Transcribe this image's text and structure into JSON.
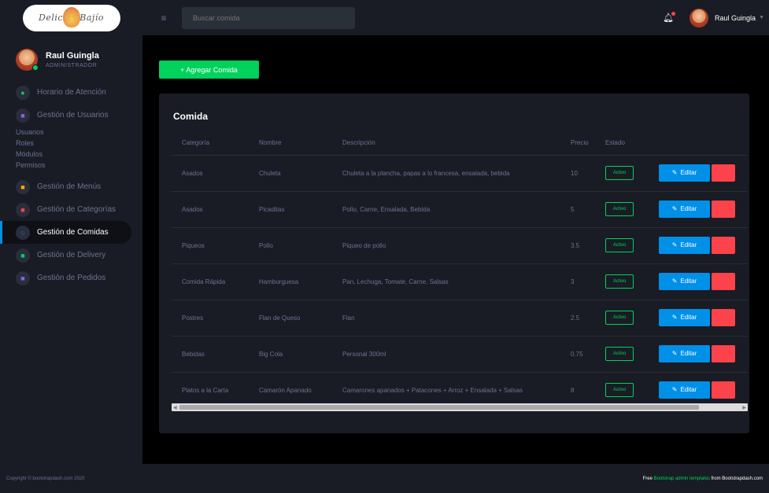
{
  "brand": {
    "logo_text": "Delicias Bajío"
  },
  "profile": {
    "name": "Raul Guingla",
    "role": "ADMINISTRADOR"
  },
  "sidebar": {
    "items": [
      {
        "label": "Horario de Atención",
        "icon": "●"
      },
      {
        "label": "Gestión de Usuarios",
        "icon": "■"
      },
      {
        "label": "Gestión de Menús",
        "icon": "■"
      },
      {
        "label": "Gestión de Categorías",
        "icon": "■"
      },
      {
        "label": "Gestión de Comidas",
        "icon": "○"
      },
      {
        "label": "Gestión de Delivery",
        "icon": "■"
      },
      {
        "label": "Gestión de Pedidos",
        "icon": "■"
      }
    ],
    "submenu": [
      "Usuarios",
      "Roles",
      "Módulos",
      "Permisos"
    ]
  },
  "topbar": {
    "search_placeholder": "Buscar comida",
    "user_name": "Raul Guingla"
  },
  "main": {
    "add_button": "+ Agregar Comida",
    "card_title": "Comida",
    "columns": [
      "Categoría",
      "Nombre",
      "Descripción",
      "Precio",
      "Estado",
      ""
    ],
    "rows": [
      {
        "categoria": "Asados",
        "nombre": "Chuleta",
        "descripcion": "Chuleta a la plancha, papas a lo francesa, ensalada, bebida",
        "precio": "10",
        "estado": "Activo"
      },
      {
        "categoria": "Asados",
        "nombre": "Picaditas",
        "descripcion": "Pollo, Carne, Ensalada, Bebida",
        "precio": "5",
        "estado": "Activo"
      },
      {
        "categoria": "Piqueos",
        "nombre": "Pollo",
        "descripcion": "Piqueo de pollo",
        "precio": "3.5",
        "estado": "Activo"
      },
      {
        "categoria": "Comida Rápida",
        "nombre": "Hamburguesa",
        "descripcion": "Pan, Lechuga, Tomate, Carne, Salsas",
        "precio": "3",
        "estado": "Activo"
      },
      {
        "categoria": "Postres",
        "nombre": "Flan de Queso",
        "descripcion": "Flan",
        "precio": "2.5",
        "estado": "Activo"
      },
      {
        "categoria": "Bebidas",
        "nombre": "Big Cola",
        "descripcion": "Personal 300ml",
        "precio": "0.75",
        "estado": "Activo"
      },
      {
        "categoria": "Platos a la Carta",
        "nombre": "Camarón Apanado",
        "descripcion": "Camarones apanados + Patacones + Arroz + Ensalada + Salsas",
        "precio": "8",
        "estado": "Activo"
      }
    ],
    "edit_label": "Editar"
  },
  "footer": {
    "left": "Copyright © bootstrapdash.com 2020",
    "right_prefix": "Free ",
    "right_link": "Bootstrap admin templates",
    "right_suffix": " from Bootstrapdash.com"
  },
  "colors": {
    "accent_green": "#00d25b",
    "accent_blue": "#0090e7",
    "accent_red": "#fc424a",
    "bg": "#000000",
    "panel": "#191c24"
  }
}
